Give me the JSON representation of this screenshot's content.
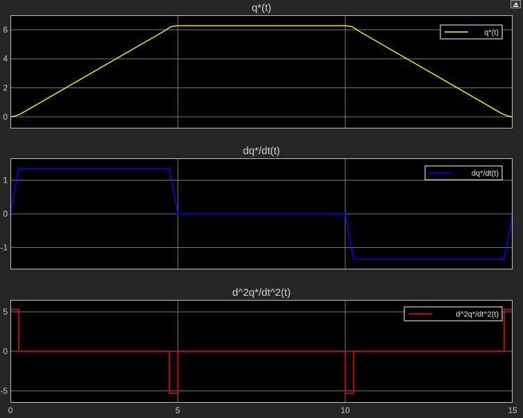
{
  "window": {
    "undock_icon": "undock-icon"
  },
  "colors": {
    "background": "#262626",
    "axes_bg": "#000000",
    "axes_border": "#bfbfbf",
    "grid": "#7a7a7a",
    "tick_text": "#c8c8c8"
  },
  "chart_data": [
    {
      "type": "line",
      "title": "q*(t)",
      "xlabel": "",
      "ylabel": "",
      "xlim": [
        0,
        15
      ],
      "ylim": [
        -0.8,
        7.0
      ],
      "xticks": [
        5,
        10
      ],
      "yticks": [
        0,
        2,
        4,
        6
      ],
      "grid": true,
      "legend": "top-right",
      "series": [
        {
          "name": "q*(t)",
          "color": "#ffff00",
          "x": [
            0,
            0.15,
            0.3,
            4.6,
            4.8,
            5.0,
            10.0,
            10.2,
            10.4,
            14.7,
            14.85,
            15.0
          ],
          "y": [
            0,
            0.06,
            0.2,
            5.92,
            6.22,
            6.28,
            6.28,
            6.22,
            5.92,
            0.2,
            0.06,
            0
          ]
        }
      ]
    },
    {
      "type": "line",
      "title": "dq*/dt(t)",
      "xlabel": "",
      "ylabel": "",
      "xlim": [
        0,
        15
      ],
      "ylim": [
        -1.65,
        1.65
      ],
      "xticks": [
        5,
        10
      ],
      "yticks": [
        -1,
        0,
        1
      ],
      "grid": true,
      "legend": "top-right",
      "series": [
        {
          "name": "dq*/dt(t)",
          "color": "#0000ff",
          "x": [
            0,
            0.25,
            4.75,
            5.0,
            10.0,
            10.25,
            14.75,
            15.0
          ],
          "y": [
            0,
            1.35,
            1.35,
            0,
            0,
            -1.35,
            -1.35,
            0
          ]
        }
      ]
    },
    {
      "type": "line",
      "title": "d^2q*/dt^2(t)",
      "xlabel": "",
      "ylabel": "",
      "xlim": [
        0,
        15
      ],
      "ylim": [
        -6.5,
        6.5
      ],
      "xticks": [
        0,
        5,
        10,
        15
      ],
      "yticks": [
        -5,
        0,
        5
      ],
      "grid": true,
      "legend": "top-right",
      "series": [
        {
          "name": "d^2q*/dt^2(t)",
          "color": "#ff0000",
          "x": [
            0,
            0.25,
            0.25,
            4.75,
            4.75,
            5.0,
            5.0,
            10.0,
            10.0,
            10.25,
            10.25,
            14.75,
            14.75,
            15.0
          ],
          "y": [
            5.3,
            5.3,
            0,
            0,
            -5.3,
            -5.3,
            0,
            0,
            -5.3,
            -5.3,
            0,
            0,
            5.3,
            5.3
          ]
        }
      ]
    }
  ]
}
